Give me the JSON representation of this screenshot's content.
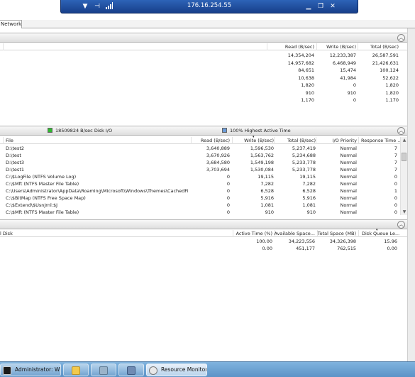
{
  "rdp": {
    "address": "176.16.254.55"
  },
  "tabs": [
    {
      "label": "Network"
    }
  ],
  "processes_table": {
    "columns": [
      "Read (B/sec)",
      "Write (B/sec)",
      "Total (B/sec)"
    ],
    "rows": [
      {
        "read": "14,354,204",
        "write": "12,233,387",
        "total": "26,587,591"
      },
      {
        "read": "14,957,682",
        "write": "6,468,949",
        "total": "21,426,631"
      },
      {
        "read": "84,651",
        "write": "15,474",
        "total": "100,124"
      },
      {
        "read": "10,638",
        "write": "41,984",
        "total": "52,622"
      },
      {
        "read": "1,820",
        "write": "0",
        "total": "1,820"
      },
      {
        "read": "910",
        "write": "910",
        "total": "1,820"
      },
      {
        "read": "1,170",
        "write": "0",
        "total": "1,170"
      }
    ]
  },
  "disk_section": {
    "io_legend": "18509824 B/sec Disk I/O",
    "active_legend": "100% Highest Active Time",
    "io_color": "#2eb82e",
    "active_color": "#6b9bd8",
    "columns": [
      "File",
      "Read (B/sec)",
      "Write (B/sec)",
      "Total (B/sec)",
      "I/O Priority",
      "Response Time ..."
    ],
    "rows": [
      {
        "file": "D:\\test2",
        "read": "3,640,889",
        "write": "1,596,530",
        "total": "5,237,419",
        "priority": "Normal",
        "response": "7"
      },
      {
        "file": "D:\\test",
        "read": "3,670,926",
        "write": "1,563,762",
        "total": "5,234,688",
        "priority": "Normal",
        "response": "7"
      },
      {
        "file": "D:\\test3",
        "read": "3,684,580",
        "write": "1,549,198",
        "total": "5,233,778",
        "priority": "Normal",
        "response": "7"
      },
      {
        "file": "D:\\test1",
        "read": "3,703,694",
        "write": "1,530,084",
        "total": "5,233,778",
        "priority": "Normal",
        "response": "7"
      },
      {
        "file": "C:\\$LogFile (NTFS Volume Log)",
        "read": "0",
        "write": "19,115",
        "total": "19,115",
        "priority": "Normal",
        "response": "0"
      },
      {
        "file": "C:\\$Mft (NTFS Master File Table)",
        "read": "0",
        "write": "7,282",
        "total": "7,282",
        "priority": "Normal",
        "response": "0"
      },
      {
        "file": "C:\\Users\\Administrator\\AppData\\Roaming\\Microsoft\\Windows\\Themes\\CachedFile...",
        "read": "0",
        "write": "6,528",
        "total": "6,528",
        "priority": "Normal",
        "response": "1"
      },
      {
        "file": "C:\\$BitMap (NTFS Free Space Map)",
        "read": "0",
        "write": "5,916",
        "total": "5,916",
        "priority": "Normal",
        "response": "0"
      },
      {
        "file": "C:\\$Extend\\$UsnJrnl:$J",
        "read": "0",
        "write": "1,081",
        "total": "1,081",
        "priority": "Normal",
        "response": "0"
      },
      {
        "file": "C:\\$Mft (NTFS Master File Table)",
        "read": "0",
        "write": "910",
        "total": "910",
        "priority": "Normal",
        "response": "0"
      }
    ]
  },
  "storage_table": {
    "columns": [
      "l Disk",
      "Active Time (%)",
      "Available Space...",
      "Total Space (MB)",
      "Disk Queue Le..."
    ],
    "rows": [
      {
        "active": "100.00",
        "available": "34,223,556",
        "total": "34,326,398",
        "queue": "15.96"
      },
      {
        "active": "0.00",
        "available": "451,177",
        "total": "762,515",
        "queue": "0.00"
      }
    ]
  },
  "taskbar": {
    "items": [
      {
        "label": "Administrator: Wi...",
        "icon": "console-icon"
      },
      {
        "label": "",
        "icon": "folder-icon"
      },
      {
        "label": "",
        "icon": "tools-icon"
      },
      {
        "label": "",
        "icon": "network-icon"
      },
      {
        "label": "Resource Monitor",
        "icon": "resource-monitor-icon"
      }
    ]
  }
}
